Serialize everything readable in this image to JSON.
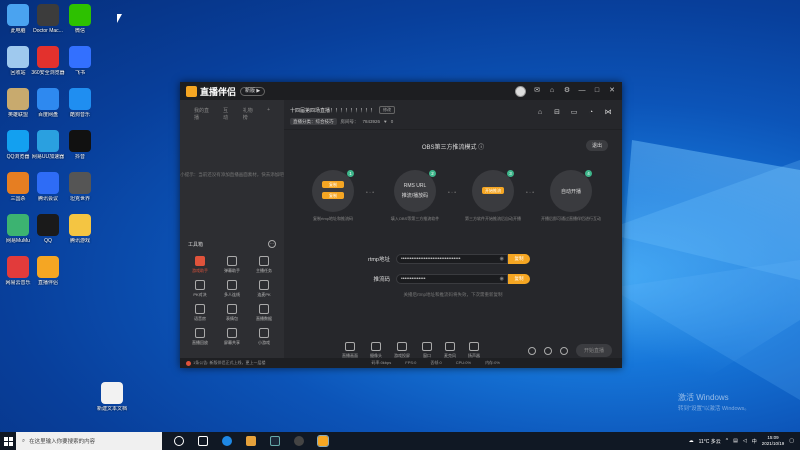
{
  "colors": {
    "accent": "#f5a623",
    "success": "#3db58a",
    "danger": "#e0533b",
    "window_bg": "#26272b"
  },
  "desktop": {
    "icons": [
      {
        "label": "此电脑",
        "color": "#4aa3f0"
      },
      {
        "label": "Doctor Mac...",
        "color": "#3c3c3c"
      },
      {
        "label": "微信",
        "color": "#2dc100"
      },
      {
        "label": "回收站",
        "color": "#9fc9ee"
      },
      {
        "label": "360安全浏览器",
        "color": "#e3312d"
      },
      {
        "label": "飞书",
        "color": "#3370ff"
      },
      {
        "label": "英雄联盟",
        "color": "#c8aa6e"
      },
      {
        "label": "百度网盘",
        "color": "#2e89f0"
      },
      {
        "label": "酷狗音乐",
        "color": "#1f8ef1"
      },
      {
        "label": "QQ浏览器",
        "color": "#13a0f0"
      },
      {
        "label": "网易UU加速器",
        "color": "#2aa0e0"
      },
      {
        "label": "抖音",
        "color": "#111111"
      },
      {
        "label": "三国杀",
        "color": "#e67e22"
      },
      {
        "label": "腾讯会议",
        "color": "#2e6cf6"
      },
      {
        "label": "坦克世界",
        "color": "#555555"
      },
      {
        "label": "网易MuMu",
        "color": "#3cb371"
      },
      {
        "label": "QQ",
        "color": "#1a1a1a"
      },
      {
        "label": "腾讯游戏",
        "color": "#f4c542"
      },
      {
        "label": "网易云音乐",
        "color": "#e23b3b"
      },
      {
        "label": "直播伴侣",
        "color": "#f5a623"
      },
      {
        "label": "新建文本文档",
        "color": "#f2f2f2"
      }
    ],
    "watermark_line1": "激活 Windows",
    "watermark_line2": "转到\"设置\"以激活 Windows。"
  },
  "app": {
    "name": "直播伴侣",
    "version": "新版 ▶",
    "left_tabs": [
      "我的直播",
      "互动",
      "礼物榜"
    ],
    "add_tab": "+",
    "empty_text": "小提示：当前还没有添加直播画面素材，快去添加吧",
    "tools_title": "工具箱",
    "tools_more": "···",
    "tools": [
      {
        "label": "游戏助手",
        "hot": true
      },
      {
        "label": "弹幕助手",
        "hot": false
      },
      {
        "label": "主播任务",
        "hot": false
      },
      {
        "label": "PK对决",
        "hot": false
      },
      {
        "label": "多人连线",
        "hot": false
      },
      {
        "label": "连麦PK",
        "hot": false
      },
      {
        "label": "语音房",
        "hot": false
      },
      {
        "label": "表情包",
        "hot": false
      },
      {
        "label": "直播数据",
        "hot": false
      },
      {
        "label": "直播回放",
        "hot": false
      },
      {
        "label": "屏幕共享",
        "hot": false
      },
      {
        "label": "小游戏",
        "hot": false
      }
    ],
    "live_title": "十四届第四场直播！！！！！！！！！",
    "edit_label": "修改",
    "category": "直播分类：综合技巧",
    "room_label": "房间号：",
    "room_id": "7843926",
    "likes": "0",
    "obs_title": "OBS第三方推流模式 ⓘ",
    "exit_label": "退出",
    "steps": [
      {
        "num": "1",
        "pill1": "复制",
        "pill2": "复制",
        "desc": "复制rtmp地址和推流码"
      },
      {
        "num": "2",
        "line1": "RMS URL",
        "line2": "推流/播放码",
        "desc": "填入OBS等第三方推流软件"
      },
      {
        "num": "3",
        "pill": "开始推流",
        "desc": "第三方软件开始推流后自动开播"
      },
      {
        "num": "4",
        "line": "自动开播",
        "desc": "开播后即可通过直播伴侣进行互动"
      }
    ],
    "rtmp_label": "rtmp地址",
    "rtmp_value": "••••••••••••••••••••••••••••••••••",
    "key_label": "推流码",
    "key_value": "••••••••••••••",
    "copy_label": "复制",
    "hint": "关播后rtmp地址和推流码将失效，下次需重新复制",
    "bottom_tools": [
      "直播画面",
      "摄像头",
      "游戏投屏",
      "窗口",
      "麦克风",
      "扬声器"
    ],
    "start_label": "开始直播",
    "status_notice": "1条公告: 新版伴侣正式上线，更上一层楼",
    "status_stats": [
      "码率:0kbps",
      "FPS:0",
      "丢帧:0",
      "CPU:0%",
      "内存:0%"
    ]
  },
  "taskbar": {
    "search_placeholder": "在这里输入你要搜索的内容",
    "weather": "11°C 多云",
    "time": "15:09",
    "date": "2021/10/19"
  }
}
